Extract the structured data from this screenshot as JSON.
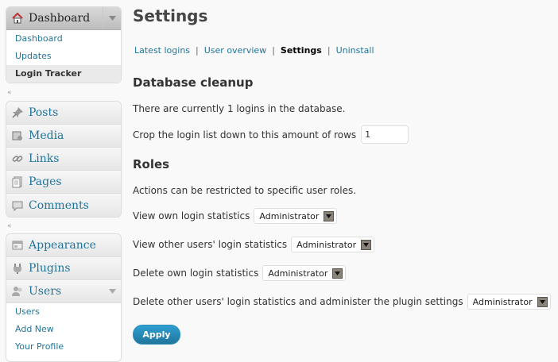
{
  "sidebar": {
    "dashboard": {
      "label": "Dashboard",
      "icon": "home-icon",
      "items": [
        {
          "label": "Dashboard"
        },
        {
          "label": "Updates"
        },
        {
          "label": "Login Tracker",
          "current": true
        }
      ]
    },
    "group1": [
      {
        "label": "Posts",
        "icon": "pushpin-icon"
      },
      {
        "label": "Media",
        "icon": "media-icon"
      },
      {
        "label": "Links",
        "icon": "link-icon"
      },
      {
        "label": "Pages",
        "icon": "pages-icon"
      },
      {
        "label": "Comments",
        "icon": "comment-icon"
      }
    ],
    "group2": [
      {
        "label": "Appearance",
        "icon": "appearance-icon"
      },
      {
        "label": "Plugins",
        "icon": "plugin-icon"
      },
      {
        "label": "Users",
        "icon": "users-icon"
      }
    ],
    "users_items": [
      {
        "label": "Users"
      },
      {
        "label": "Add New"
      },
      {
        "label": "Your Profile"
      }
    ]
  },
  "page": {
    "title": "Settings",
    "tabs": [
      {
        "label": "Latest logins"
      },
      {
        "label": "User overview"
      },
      {
        "label": "Settings",
        "current": true
      },
      {
        "label": "Uninstall"
      }
    ],
    "tab_separator": "|",
    "db_cleanup": {
      "heading": "Database cleanup",
      "status_text": "There are currently 1 logins in the database.",
      "crop_label": "Crop the login list down to this amount of rows",
      "crop_value": "1"
    },
    "roles": {
      "heading": "Roles",
      "intro": "Actions can be restricted to specific user roles.",
      "rows": [
        {
          "label": "View own login statistics",
          "value": "Administrator"
        },
        {
          "label": "View other users' login statistics",
          "value": "Administrator"
        },
        {
          "label": "Delete own login statistics",
          "value": "Administrator"
        },
        {
          "label": "Delete other users' login statistics and administer the plugin settings",
          "value": "Administrator"
        }
      ]
    },
    "apply_label": "Apply"
  },
  "colors": {
    "link": "#21759b",
    "button": "#21759b",
    "background": "#f9f9f9"
  }
}
